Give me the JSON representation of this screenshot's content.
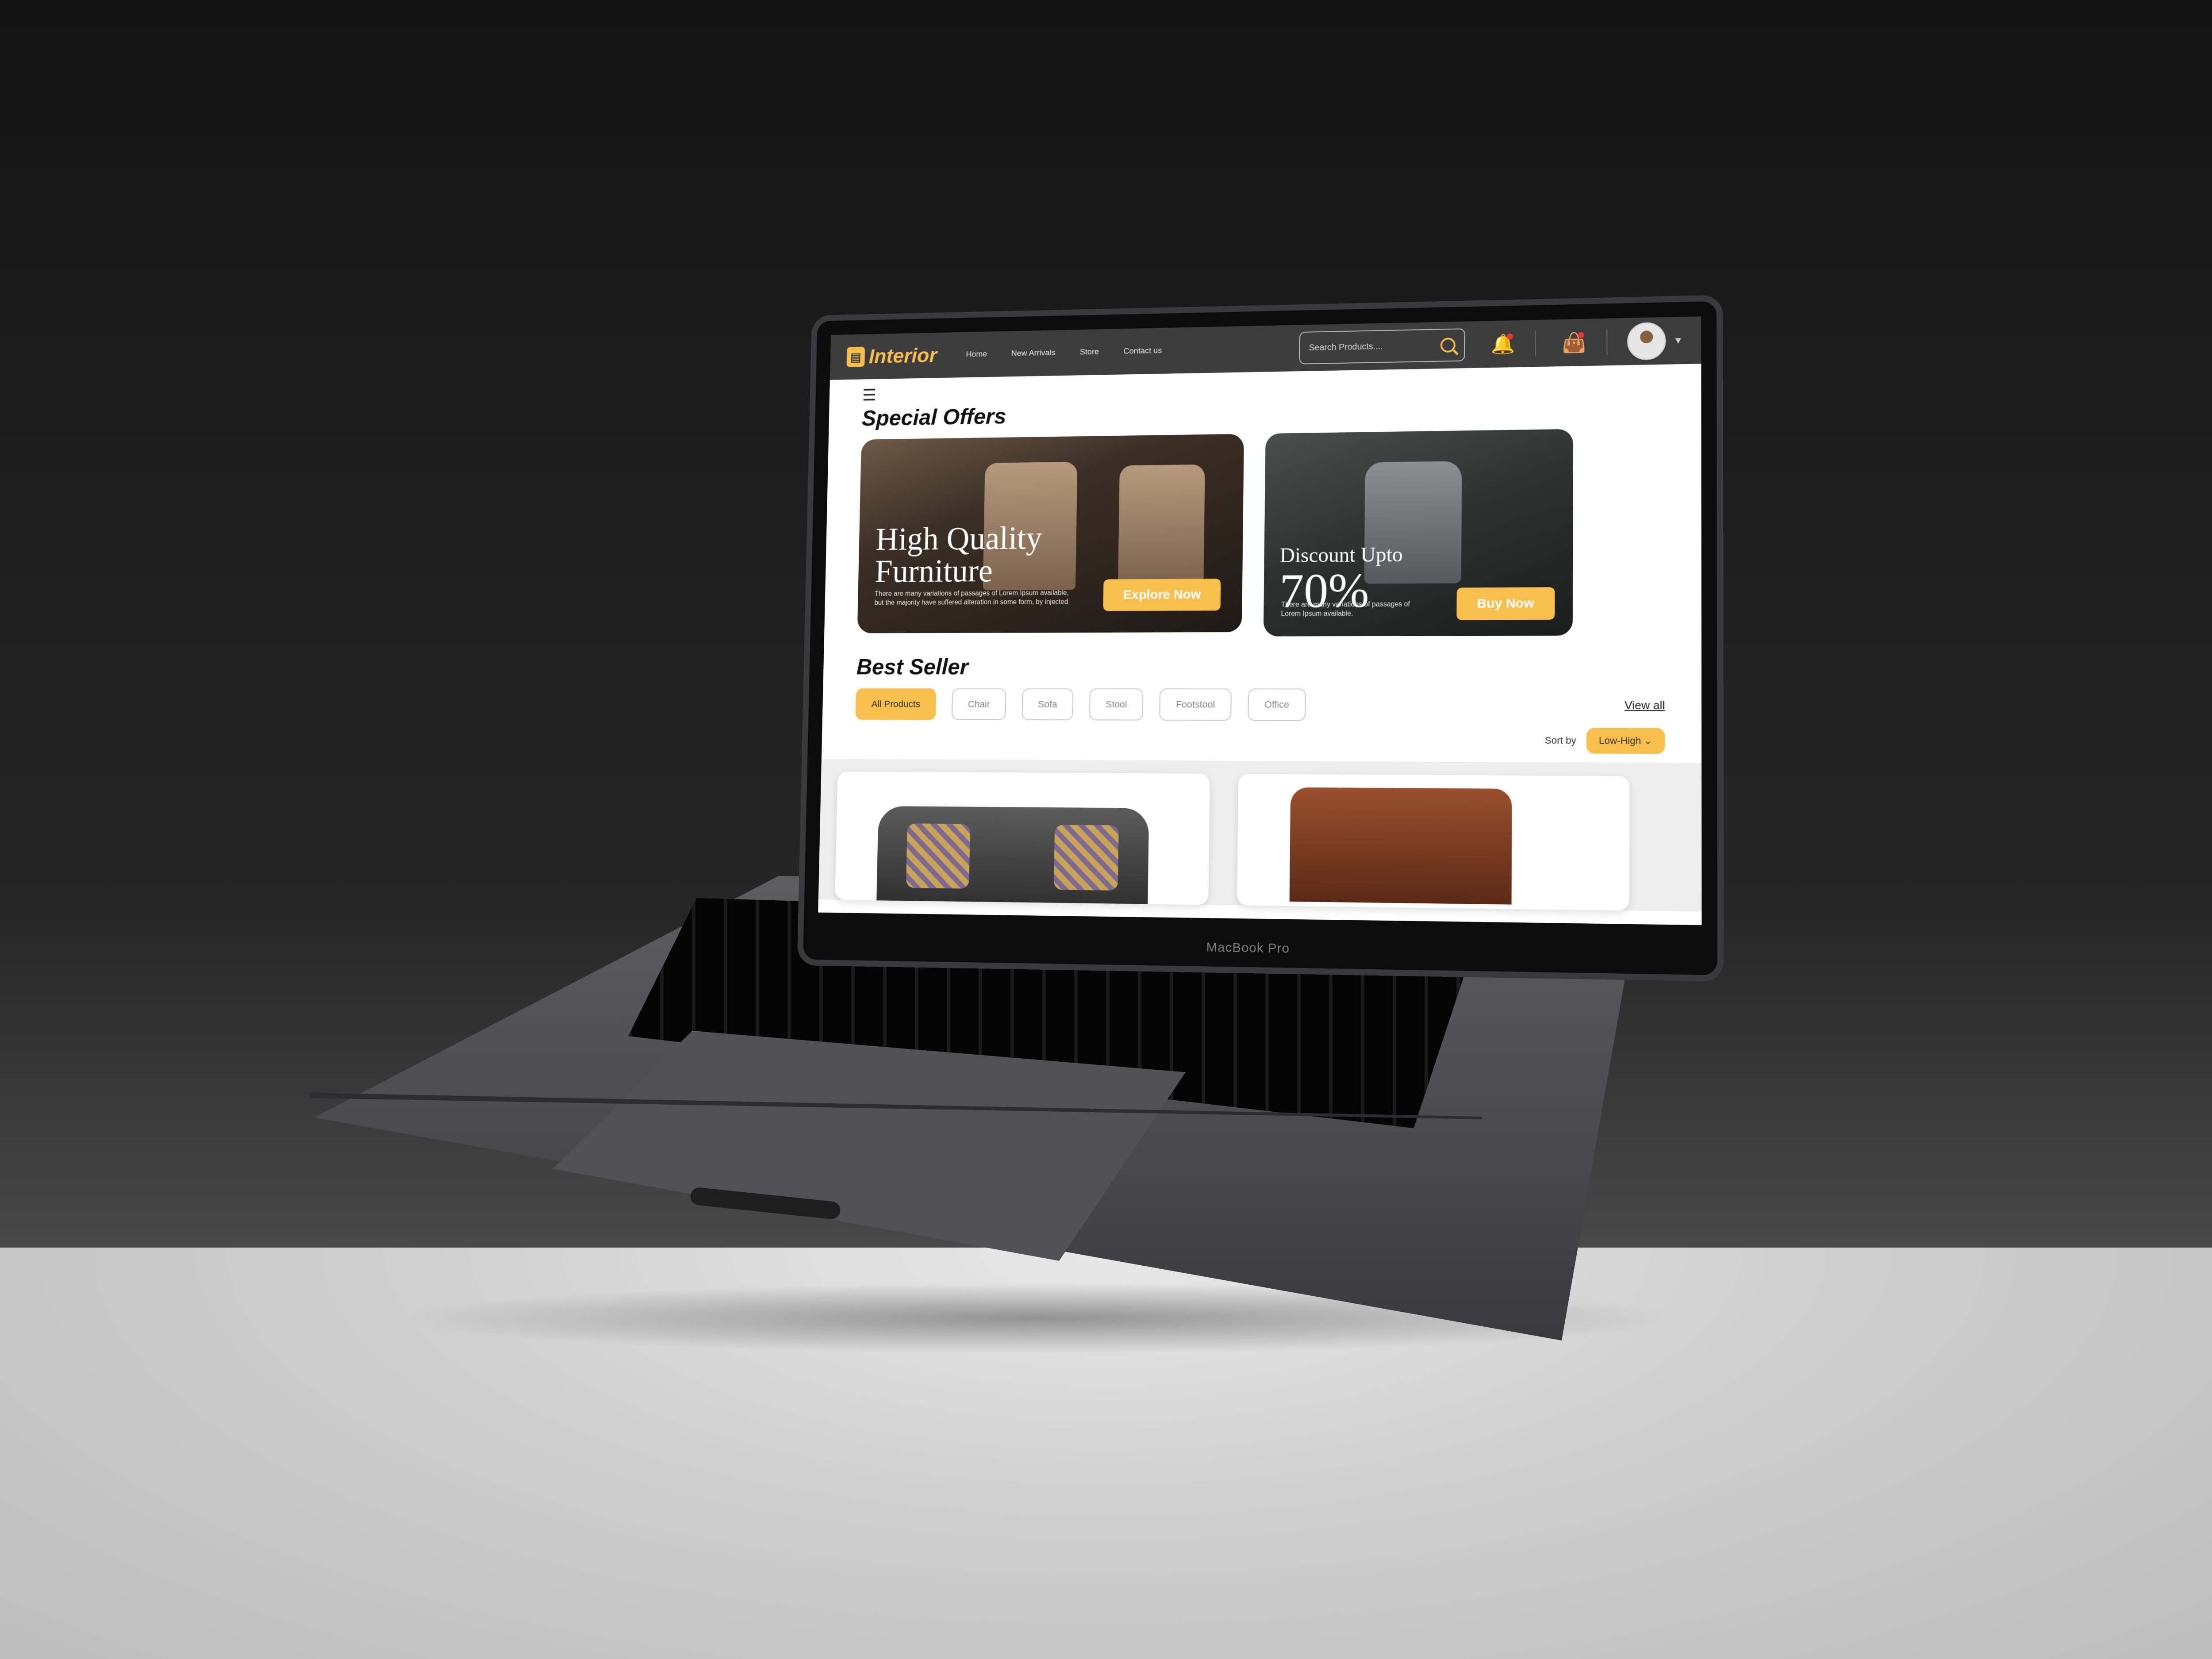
{
  "laptop": {
    "label": "MacBook Pro"
  },
  "header": {
    "logo_text": "Interior",
    "nav": [
      "Home",
      "New Arrivals",
      "Store",
      "Contact us"
    ],
    "search_placeholder": "Search Products....",
    "accent_color": "#f8bf4f"
  },
  "offers": {
    "title": "Special Offers",
    "card1": {
      "title_line1": "High Quality",
      "title_line2": "Furniture",
      "desc": "There are many variations of passages of Lorem Ipsum available, but the majority have suffered alteration in some form, by injected",
      "cta": "Explore Now"
    },
    "card2": {
      "title": "Discount Upto",
      "percent": "70%",
      "desc": "There are many variations of passages of Lorem Ipsum available.",
      "cta": "Buy Now"
    }
  },
  "best_seller": {
    "title": "Best Seller",
    "chips": [
      "All Products",
      "Chair",
      "Sofa",
      "Stool",
      "Footstool",
      "Office"
    ],
    "view_all": "View all",
    "sort_label": "Sort by",
    "sort_value": "Low-High"
  },
  "icons": [
    "menu-icon",
    "search-icon",
    "bell-icon",
    "shopping-bag-icon",
    "avatar",
    "chevron-down-icon"
  ]
}
